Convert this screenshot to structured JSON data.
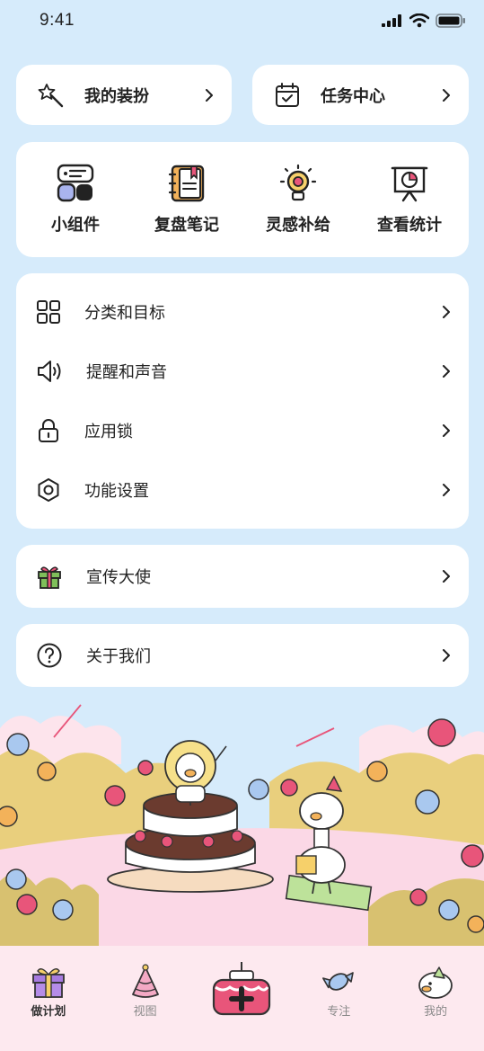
{
  "status": {
    "time": "9:41"
  },
  "top_cards": [
    {
      "label": "我的装扮",
      "icon": "magic-wand-icon"
    },
    {
      "label": "任务中心",
      "icon": "calendar-check-icon"
    }
  ],
  "grid": [
    {
      "label": "小组件",
      "icon": "widget-icon"
    },
    {
      "label": "复盘笔记",
      "icon": "notebook-icon"
    },
    {
      "label": "灵感补给",
      "icon": "lightbulb-icon"
    },
    {
      "label": "查看统计",
      "icon": "chart-board-icon"
    }
  ],
  "menu_settings": [
    {
      "label": "分类和目标",
      "icon": "grid-icon"
    },
    {
      "label": "提醒和声音",
      "icon": "speaker-icon"
    },
    {
      "label": "应用锁",
      "icon": "lock-icon"
    },
    {
      "label": "功能设置",
      "icon": "hexagon-settings-icon"
    }
  ],
  "menu_ambassador": {
    "label": "宣传大使",
    "icon": "gift-icon"
  },
  "menu_about": {
    "label": "关于我们",
    "icon": "question-icon"
  },
  "tabbar": [
    {
      "label": "做计划",
      "icon": "gift-box-icon",
      "active": true
    },
    {
      "label": "视图",
      "icon": "party-hat-icon",
      "active": false
    },
    {
      "label": "",
      "icon": "cake-add-icon",
      "active": false
    },
    {
      "label": "专注",
      "icon": "candy-icon",
      "active": false
    },
    {
      "label": "我的",
      "icon": "duck-avatar-icon",
      "active": false
    }
  ],
  "colors": {
    "background": "#d6ebfb",
    "tabbar": "#fde9ef",
    "accent": "#e8557a"
  }
}
